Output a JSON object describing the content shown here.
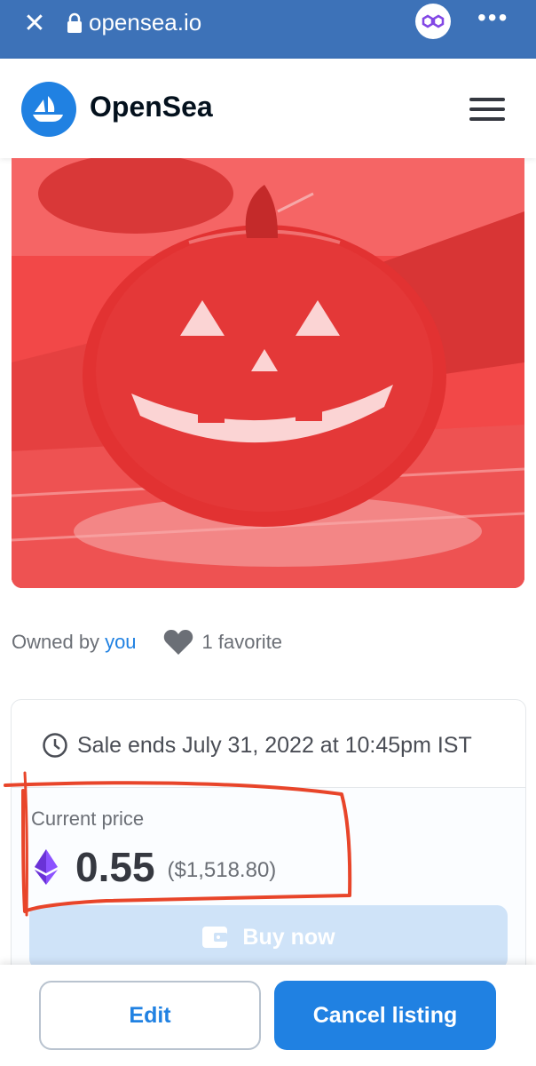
{
  "browser": {
    "close_icon": "close-icon",
    "url": "opensea.io",
    "more_label": "•••"
  },
  "header": {
    "brand": "OpenSea"
  },
  "ownership": {
    "owned_by_label": "Owned by",
    "owner": "you",
    "favorites": "1 favorite"
  },
  "sale": {
    "ends_text": "Sale ends July 31, 2022 at 10:45pm IST",
    "current_price_label": "Current price",
    "price": "0.55",
    "price_usd": "($1,518.80)",
    "buy_label": "Buy now"
  },
  "actions": {
    "edit_label": "Edit",
    "cancel_label": "Cancel listing"
  },
  "colors": {
    "brand_blue": "#2081e2",
    "browser_bar": "#3d72b8",
    "artwork_red": "#f14a4a",
    "highlight": "#e8452a"
  }
}
